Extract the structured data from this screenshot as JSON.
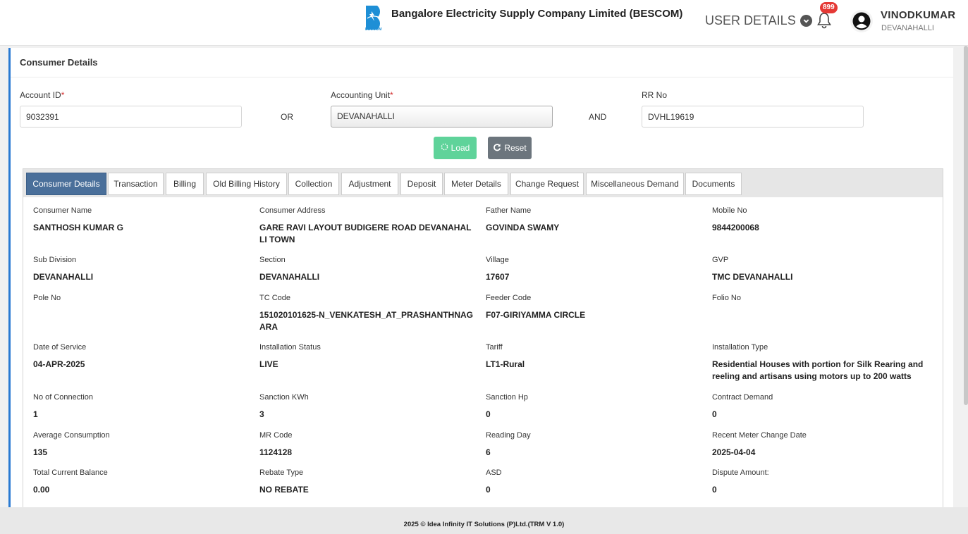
{
  "header": {
    "logo_text": "BESCOM",
    "company": "Bangalore Electricity Supply Company Limited (BESCOM)",
    "user_details_label": "USER DETAILS",
    "notification_count": "899",
    "user_name": "VINODKUMAR",
    "user_location": "DEVANAHALLI"
  },
  "card": {
    "title": "Consumer Details"
  },
  "form": {
    "account_id_label": "Account ID",
    "account_id_value": "9032391",
    "or_label": "OR",
    "accounting_unit_label": "Accounting Unit",
    "accounting_unit_value": "DEVANAHALLI",
    "and_label": "AND",
    "rr_no_label": "RR No",
    "rr_no_value": "DVHL19619",
    "required_mark": "*",
    "load_label": "Load",
    "reset_label": "Reset"
  },
  "tabs": [
    "Consumer Details",
    "Transaction",
    "Billing",
    "Old Billing History",
    "Collection",
    "Adjustment",
    "Deposit",
    "Meter Details",
    "Change Request",
    "Miscellaneous Demand",
    "Documents"
  ],
  "fields": [
    {
      "label": "Consumer Name",
      "value": "SANTHOSH KUMAR G"
    },
    {
      "label": "Consumer Address",
      "value": "GARE RAVI LAYOUT BUDIGERE ROAD DEVANAHALLI TOWN"
    },
    {
      "label": "Father Name",
      "value": "GOVINDA SWAMY"
    },
    {
      "label": "Mobile No",
      "value": "9844200068"
    },
    {
      "label": "Sub Division",
      "value": "DEVANAHALLI"
    },
    {
      "label": "Section",
      "value": "DEVANAHALLI"
    },
    {
      "label": "Village",
      "value": "17607"
    },
    {
      "label": "GVP",
      "value": "TMC DEVANAHALLI"
    },
    {
      "label": "Pole No",
      "value": ""
    },
    {
      "label": "TC Code",
      "value": "151020101625-N_VENKATESH_AT_PRASHANTHNAGARA"
    },
    {
      "label": "Feeder Code",
      "value": "F07-GIRIYAMMA CIRCLE"
    },
    {
      "label": "Folio No",
      "value": ""
    },
    {
      "label": "Date of Service",
      "value": "04-APR-2025"
    },
    {
      "label": "Installation Status",
      "value": "LIVE"
    },
    {
      "label": "Tariff",
      "value": "LT1-Rural"
    },
    {
      "label": "Installation Type",
      "value": "Residential Houses with portion for Silk Rearing and reeling and artisans using motors up to 200 watts"
    },
    {
      "label": "No of Connection",
      "value": "1"
    },
    {
      "label": "Sanction KWh",
      "value": "3"
    },
    {
      "label": "Sanction Hp",
      "value": "0"
    },
    {
      "label": "Contract Demand",
      "value": "0"
    },
    {
      "label": "Average Consumption",
      "value": "135"
    },
    {
      "label": "MR Code",
      "value": "1124128"
    },
    {
      "label": "Reading Day",
      "value": "6"
    },
    {
      "label": "Recent Meter Change Date",
      "value": "2025-04-04"
    },
    {
      "label": "Total Current Balance",
      "value": "0.00"
    },
    {
      "label": "Rebate Type",
      "value": "NO REBATE"
    },
    {
      "label": "ASD",
      "value": "0"
    },
    {
      "label": "Dispute Amount:",
      "value": "0"
    }
  ],
  "footer": {
    "text": "2025 © Idea Infinity IT Solutions (P)Ltd.(TRM V 1.0)"
  },
  "colors": {
    "accent": "#2a7ad2",
    "active_tab": "#4a6f9a",
    "load_button": "#5fd39a",
    "reset_button": "#6c757d",
    "badge": "#e53935"
  }
}
